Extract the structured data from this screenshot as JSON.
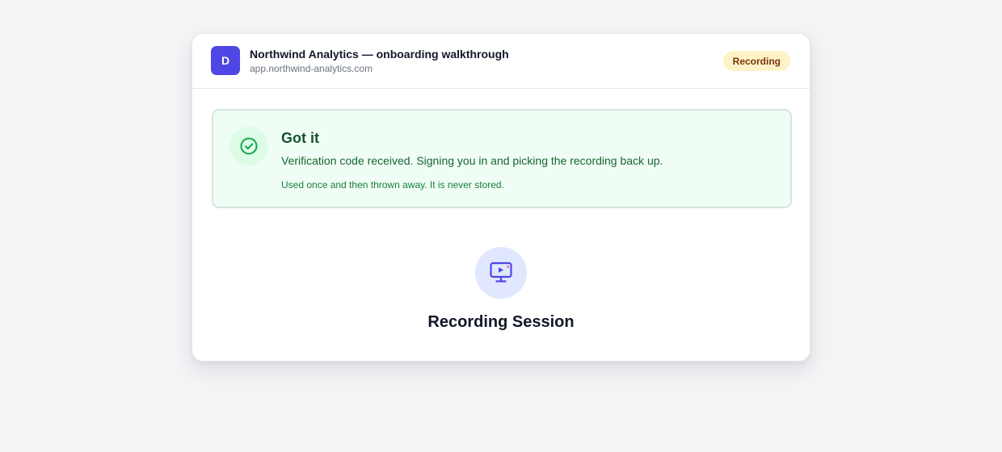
{
  "header": {
    "avatar_letter": "D",
    "title": "Northwind Analytics — onboarding walkthrough",
    "url": "app.northwind-analytics.com",
    "status_badge": "Recording"
  },
  "alert": {
    "icon": "check-circle-icon",
    "title": "Got it",
    "message": "Verification code received. Signing you in and picking the recording back up.",
    "note": "Used once and then thrown away. It is never stored."
  },
  "session": {
    "icon": "monitor-play-icon",
    "title": "Recording Session"
  },
  "colors": {
    "accent": "#4f46e5",
    "success": "#16a34a",
    "badge_bg": "#fef3c7",
    "page_bg": "#f3f4f6"
  }
}
